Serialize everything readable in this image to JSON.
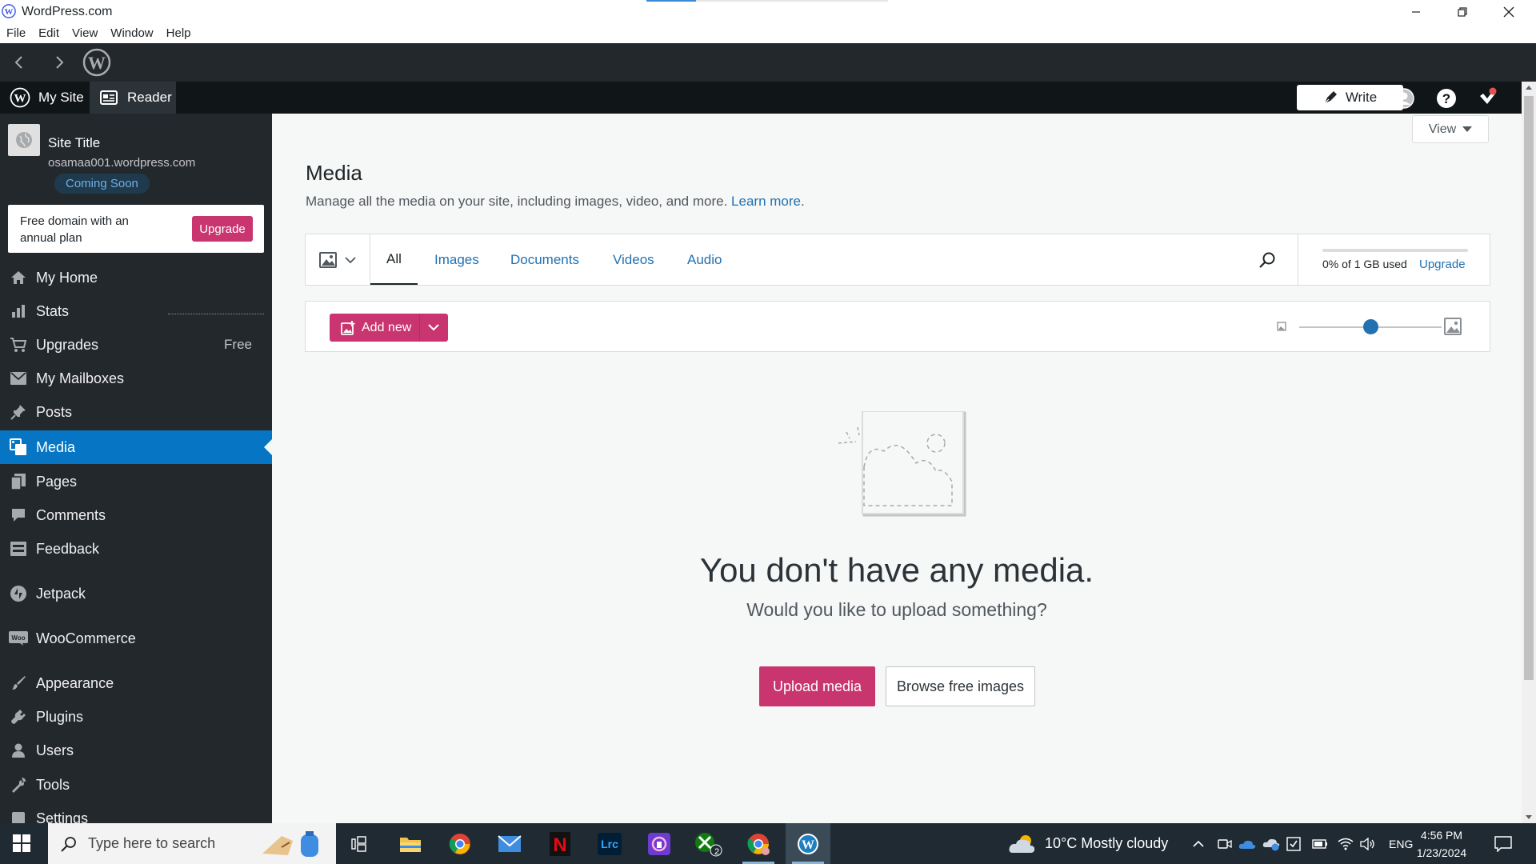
{
  "window": {
    "title": "WordPress.com",
    "menu": [
      "File",
      "Edit",
      "View",
      "Window",
      "Help"
    ]
  },
  "adminbar": {
    "my_site": "My Site",
    "reader": "Reader",
    "write": "Write"
  },
  "sidebar": {
    "site_title": "Site Title",
    "site_url": "osamaa001.wordpress.com",
    "coming_soon": "Coming Soon",
    "upsell_text": "Free domain with an annual plan",
    "upsell_button": "Upgrade",
    "items": [
      {
        "label": "My Home",
        "icon": "home-icon"
      },
      {
        "label": "Stats",
        "icon": "stats-icon"
      },
      {
        "label": "Upgrades",
        "icon": "cart-icon",
        "extra": "Free"
      },
      {
        "label": "My Mailboxes",
        "icon": "mail-icon"
      },
      {
        "label": "Posts",
        "icon": "pin-icon"
      },
      {
        "label": "Media",
        "icon": "media-icon",
        "active": true
      },
      {
        "label": "Pages",
        "icon": "pages-icon"
      },
      {
        "label": "Comments",
        "icon": "comment-icon"
      },
      {
        "label": "Feedback",
        "icon": "feedback-icon"
      },
      {
        "label": "Jetpack",
        "icon": "jetpack-icon"
      },
      {
        "label": "WooCommerce",
        "icon": "woo-icon"
      },
      {
        "label": "Appearance",
        "icon": "brush-icon"
      },
      {
        "label": "Plugins",
        "icon": "plug-icon"
      },
      {
        "label": "Users",
        "icon": "user-icon"
      },
      {
        "label": "Tools",
        "icon": "wrench-icon"
      },
      {
        "label": "Settings",
        "icon": "settings-icon"
      }
    ]
  },
  "main": {
    "view_button": "View",
    "title": "Media",
    "description": "Manage all the media on your site, including images, video, and more.",
    "learn_more": "Learn more",
    "tabs": [
      "All",
      "Images",
      "Documents",
      "Videos",
      "Audio"
    ],
    "active_tab": "All",
    "storage_text": "0% of 1 GB used",
    "storage_upgrade": "Upgrade",
    "storage_used_fraction": 0,
    "add_new": "Add new",
    "zoom_level": 0.5,
    "empty_title": "You don't have any media.",
    "empty_subtitle": "Would you like to upload something?",
    "upload_button": "Upload media",
    "browse_button": "Browse free images"
  },
  "taskbar": {
    "search_placeholder": "Type here to search",
    "weather": "10°C  Mostly cloudy",
    "language": "ENG",
    "time": "4:56 PM",
    "date": "1/23/2024",
    "xbox_badge": "2"
  },
  "colors": {
    "accent_pink": "#c9356e",
    "active_blue": "#0675c4",
    "sidebar_bg": "#23282d",
    "link_blue": "#2271b1"
  }
}
